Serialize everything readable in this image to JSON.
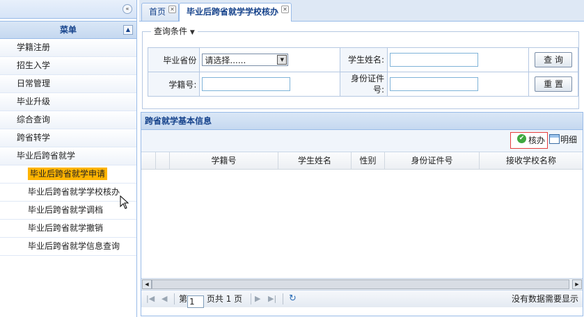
{
  "sidebar": {
    "collapse_icon": "double-chevron-left-icon",
    "header": "菜单",
    "header_icon": "chevron-up-icon",
    "items": [
      {
        "label": "学籍注册"
      },
      {
        "label": "招生入学"
      },
      {
        "label": "日常管理"
      },
      {
        "label": "毕业升级"
      },
      {
        "label": "综合查询"
      },
      {
        "label": "跨省转学"
      },
      {
        "label": "毕业后跨省就学"
      }
    ],
    "subitems": [
      {
        "label": "毕业后跨省就学申请",
        "selected": true
      },
      {
        "label": "毕业后跨省就学学校核办"
      },
      {
        "label": "毕业后跨省就学调档"
      },
      {
        "label": "毕业后跨省就学撤销"
      },
      {
        "label": "毕业后跨省就学信息查询"
      }
    ]
  },
  "tabs": [
    {
      "label": "首页",
      "active": false
    },
    {
      "label": "毕业后跨省就学学校核办",
      "active": true
    }
  ],
  "query": {
    "legend": "查询条件",
    "province_label": "毕业省份",
    "province_value": "请选择......",
    "name_label": "学生姓名:",
    "name_value": "",
    "student_id_label": "学籍号:",
    "student_id_value": "",
    "id_card_label_line1": "身份证件",
    "id_card_label_line2": "号:",
    "id_card_value": "",
    "search_button": "查 询",
    "reset_button": "重 置"
  },
  "grid": {
    "title": "跨省就学基本信息",
    "toolbar": {
      "approve": "核办",
      "detail": "明细"
    },
    "columns": [
      "学籍号",
      "学生姓名",
      "性别",
      "身份证件号",
      "接收学校名称"
    ],
    "rows": []
  },
  "pager": {
    "page_prefix": "第",
    "page_value": "1",
    "page_suffix": "页共 1 页",
    "status": "没有数据需要显示"
  },
  "colors": {
    "accent": "#15428b",
    "border": "#99bbe8",
    "selected": "#ffb400"
  }
}
